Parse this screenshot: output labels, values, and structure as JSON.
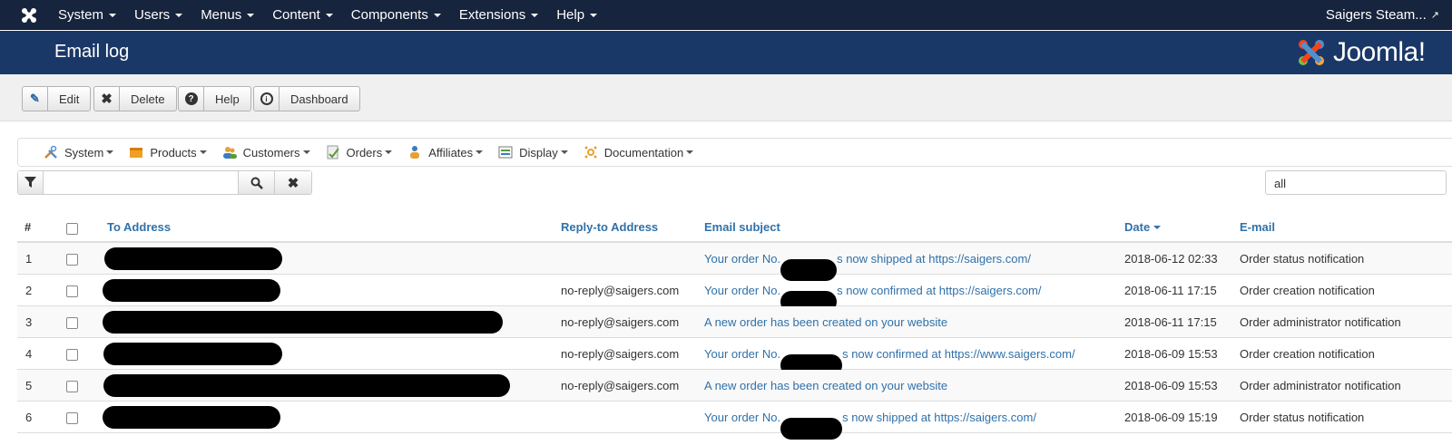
{
  "topnav": {
    "menu": [
      "System",
      "Users",
      "Menus",
      "Content",
      "Components",
      "Extensions",
      "Help"
    ],
    "site_name": "Saigers Steam...",
    "logo_icon": "joomla-icon",
    "external_icon": "external-link-icon"
  },
  "header": {
    "title": "Email log",
    "brand": "Joomla!"
  },
  "toolbar": {
    "buttons": [
      {
        "label": "Edit",
        "icon": "edit-icon"
      },
      {
        "label": "Delete",
        "icon": "close-icon"
      },
      {
        "label": "Help",
        "icon": "question-icon"
      },
      {
        "label": "Dashboard",
        "icon": "info-icon"
      }
    ]
  },
  "component_menu": {
    "items": [
      {
        "label": "System",
        "icon": "tools-icon"
      },
      {
        "label": "Products",
        "icon": "box-icon"
      },
      {
        "label": "Customers",
        "icon": "users-icon"
      },
      {
        "label": "Orders",
        "icon": "orders-icon"
      },
      {
        "label": "Affiliates",
        "icon": "affiliates-icon"
      },
      {
        "label": "Display",
        "icon": "display-icon"
      },
      {
        "label": "Documentation",
        "icon": "documentation-icon"
      }
    ]
  },
  "filter": {
    "search_value": "",
    "limit_value": "all"
  },
  "table": {
    "headers": {
      "num": "#",
      "to_address": "To Address",
      "reply_to": "Reply-to Address",
      "subject": "Email subject",
      "date": "Date",
      "email": "E-mail"
    },
    "sort_column": "Date",
    "rows": [
      {
        "num": "1",
        "reply_to": "",
        "subject_prefix": "Your order No.",
        "subject_suffix": "s now shipped at https://saigers.com/",
        "subject_full": "",
        "date": "2018-06-12 02:33",
        "email": "Order status notification"
      },
      {
        "num": "2",
        "reply_to": "no-reply@saigers.com",
        "subject_prefix": "Your order No.",
        "subject_suffix": "s now confirmed at https://saigers.com/",
        "subject_full": "",
        "date": "2018-06-11 17:15",
        "email": "Order creation notification"
      },
      {
        "num": "3",
        "reply_to": "no-reply@saigers.com",
        "subject_prefix": "",
        "subject_suffix": "",
        "subject_full": "A new order has been created on your website",
        "date": "2018-06-11 17:15",
        "email": "Order administrator notification"
      },
      {
        "num": "4",
        "reply_to": "no-reply@saigers.com",
        "subject_prefix": "Your order No.",
        "subject_suffix": "s now confirmed at https://www.saigers.com/",
        "subject_full": "",
        "date": "2018-06-09 15:53",
        "email": "Order creation notification"
      },
      {
        "num": "5",
        "reply_to": "no-reply@saigers.com",
        "subject_prefix": "",
        "subject_suffix": "",
        "subject_full": "A new order has been created on your website",
        "date": "2018-06-09 15:53",
        "email": "Order administrator notification"
      },
      {
        "num": "6",
        "reply_to": "",
        "subject_prefix": "Your order No.",
        "subject_suffix": "s now shipped at https://saigers.com/",
        "subject_full": "",
        "date": "2018-06-09 15:19",
        "email": "Order status notification"
      }
    ]
  }
}
